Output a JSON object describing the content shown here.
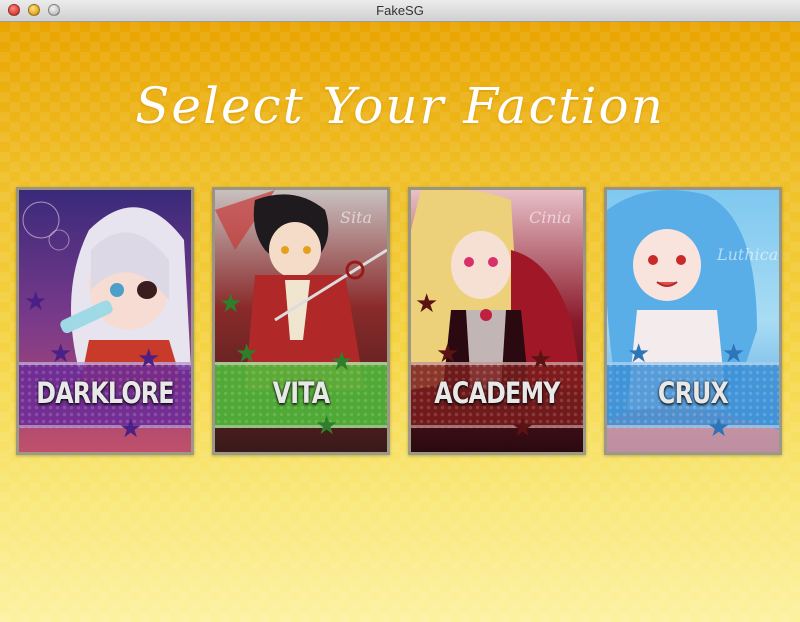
{
  "window": {
    "title": "FakeSG"
  },
  "heading": "Select Your Faction",
  "factions": [
    {
      "name": "DARKLORE",
      "signature": "",
      "band_color": "#6a2a9a",
      "art": "white-haired-girl-eyepatch",
      "star_color": "#4a1f86"
    },
    {
      "name": "VITA",
      "signature": "Sita",
      "band_color": "#4fc23a",
      "art": "dark-haired-swordsman",
      "star_color": "#2f7f2a"
    },
    {
      "name": "ACADEMY",
      "signature": "Cinia",
      "band_color": "#7a1c1c",
      "art": "blonde-girl-red-dress",
      "star_color": "#5a1212"
    },
    {
      "name": "CRUX",
      "signature": "Luthica",
      "band_color": "#3b8fd6",
      "art": "blue-haired-girl",
      "star_color": "#2d74b8"
    }
  ]
}
